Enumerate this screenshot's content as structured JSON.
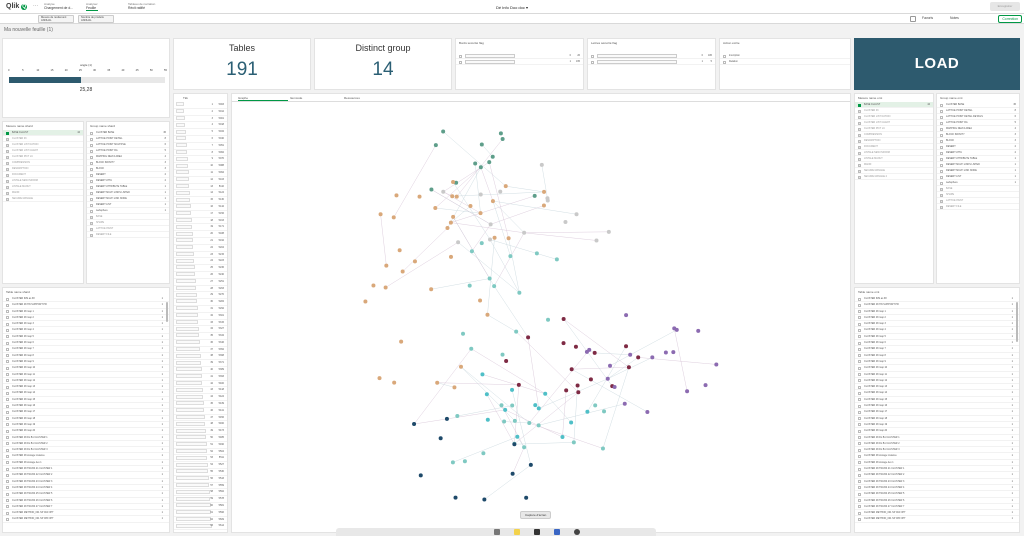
{
  "topbar": {
    "logo": "Qlik",
    "logo_mark": "Q",
    "more_glyph": "···",
    "crumbs": [
      {
        "key": "Analyse",
        "value": "Chargement de d..."
      },
      {
        "key": "Analyser",
        "value": "Feuille"
      },
      {
        "key": "Tableau de narration",
        "value": "Récit ratifié"
      }
    ],
    "app_title": "Dé Info Doo doc",
    "chevron": "▾",
    "pill1": "Modifier la feuille",
    "pill2": "Feuille",
    "edit_label": "Enregistrer"
  },
  "toolbar": {
    "selection1": "Mesure de rendement",
    "selection1b": "ANNUAL",
    "selection2": "Nombre de produits",
    "selection2b": "ANNUAL",
    "favorites": "Favoris",
    "notes": "Notes",
    "sheet_btn": "Correction"
  },
  "sheet_title": "Ma nouvelle feuille (1)",
  "slider": {
    "title": "angle (1)",
    "value": "25,28",
    "ticks": [
      "0",
      "5",
      "10",
      "15",
      "20",
      "25",
      "30",
      "35",
      "40",
      "45",
      "50",
      "55"
    ],
    "fill_fraction": 0.46
  },
  "kpi_tables": {
    "title": "Tables",
    "value": "191"
  },
  "kpi_groups": {
    "title": "Distinct group",
    "value": "14"
  },
  "filter1": {
    "title": "Bords sécurité flag",
    "rows": [
      {
        "label": "",
        "a": "0",
        "b": "26"
      },
      {
        "label": "",
        "a": "1",
        "b": "165"
      }
    ]
  },
  "filter2": {
    "title": "Lettres sécurité flag",
    "rows": [
      {
        "label": "",
        "a": "0",
        "b": "186"
      },
      {
        "label": "",
        "a": "1",
        "b": "5"
      }
    ]
  },
  "filter3": {
    "title": "Action écrite",
    "rows": [
      {
        "label": "Inscription",
        "a": "",
        "b": ""
      },
      {
        "label": "Relation",
        "a": "",
        "b": ""
      }
    ]
  },
  "load_label": "LOAD",
  "list_left1": {
    "title": "Mesure name shard",
    "items": [
      {
        "label": "BASE CLLUST",
        "n": "44",
        "state": "s"
      },
      {
        "label": "CLUSTER 03",
        "n": "",
        "state": "g"
      },
      {
        "label": "CLUSTER LIST NATION",
        "n": "",
        "state": "g"
      },
      {
        "label": "CLUSTER LIST CLIENT",
        "n": "",
        "state": "g"
      },
      {
        "label": "CLUSTER PICT LC",
        "n": "",
        "state": "g"
      },
      {
        "label": "COMPRESSION",
        "n": "",
        "state": "g"
      },
      {
        "label": "DESCRIPTION",
        "n": "",
        "state": "g"
      },
      {
        "label": "DOCUMENT",
        "n": "",
        "state": "g"
      },
      {
        "label": "LINTALE NEW INFORM",
        "n": "",
        "state": "g"
      },
      {
        "label": "LINTALE MANUT",
        "n": "",
        "state": "g"
      },
      {
        "label": "MANIF",
        "n": "",
        "state": "g"
      },
      {
        "label": "SECURE MANAGE",
        "n": "",
        "state": "g"
      }
    ]
  },
  "list_left2": {
    "title": "Group name shard",
    "items": [
      {
        "label": "CLUSTER BASE",
        "n": "36",
        "state": ""
      },
      {
        "label": "LATTICE POINT DETAIL",
        "n": "8",
        "state": ""
      },
      {
        "label": "LATTICE POINT MULTIPLE",
        "n": "6",
        "state": ""
      },
      {
        "label": "LATTICE POINT RA",
        "n": "5",
        "state": ""
      },
      {
        "label": "MAPPING DELTA AREA",
        "n": "4",
        "state": ""
      },
      {
        "label": "BLOCK INFINITY",
        "n": "3",
        "state": ""
      },
      {
        "label": "BLOCK",
        "n": "3",
        "state": ""
      },
      {
        "label": "DESERT",
        "n": "2",
        "state": ""
      },
      {
        "label": "DESERT ATTA",
        "n": "2",
        "state": ""
      },
      {
        "label": "DESERT ATTRIBUTE TABLE",
        "n": "1",
        "state": ""
      },
      {
        "label": "DESERT MULTI LINKS LISTED",
        "n": "1",
        "state": ""
      },
      {
        "label": "DESERT MULTI LINK NODE",
        "n": "1",
        "state": ""
      },
      {
        "label": "DESERT LIST",
        "n": "1",
        "state": ""
      },
      {
        "label": "websphere",
        "n": "1",
        "state": ""
      },
      {
        "label": "BASE",
        "n": "",
        "state": "g"
      },
      {
        "label": "SHAPE",
        "n": "",
        "state": "g"
      },
      {
        "label": "LATTICE PAINT",
        "n": "",
        "state": "g"
      },
      {
        "label": "DESERT FILE",
        "n": "",
        "state": "g"
      }
    ]
  },
  "list_bottom_left": {
    "title": "Table name shard",
    "items": [
      "CLUSTER IMS as 38",
      "CLUSTER 48 HN SUPPORT PR",
      "CLUSTER 48 map 1",
      "CLUSTER 48 map 2",
      "CLUSTER 48 map 3",
      "CLUSTER 48 map 4",
      "CLUSTER 48 map 5",
      "CLUSTER 48 map 6",
      "CLUSTER 48 map 7",
      "CLUSTER 48 map 8",
      "CLUSTER 48 map 9",
      "CLUSTER 48 map 10",
      "CLUSTER 48 map 11",
      "CLUSTER 48 map 12",
      "CLUSTER 48 map 13",
      "CLUSTER 48 map 14",
      "CLUSTER 48 map 15",
      "CLUSTER 48 map 16",
      "CLUSTER 48 map 17",
      "CLUSTER 48 map 18",
      "CLUSTER 48 map 19",
      "CLUSTER 48 map 20",
      "CLUSTER 48 DL B1 CLUSTER 1",
      "CLUSTER 48 DL B1 CLUSTER 2",
      "CLUSTER 48 DL B1 CLUSTER 3",
      "CLUSTER 48 storage instance",
      "CLUSTER 48 storage dev 1",
      "CLUSTER 48 TRANS 21 CLUSTER 1",
      "CLUSTER 48 TRANS 22 CLUSTER 2",
      "CLUSTER 48 TRANS 23 CLUSTER 3",
      "CLUSTER 48 TRANS 24 CLUSTER 4",
      "CLUSTER 48 TRANS 25 CLUSTER 5",
      "CLUSTER 48 TRANS 26 CLUSTER 6",
      "CLUSTER 48 TRANS 27 CLUSTER 7",
      "CLUSTER METHOD_001 SP 004 OPT",
      "CLUSTER METHOD_001 SP 005 OPT"
    ]
  },
  "numlist": {
    "title": "Tkk",
    "items": [
      [
        "1",
        "5003"
      ],
      [
        "2",
        "5012"
      ],
      [
        "3",
        "5001"
      ],
      [
        "4",
        "5018"
      ],
      [
        "5",
        "5034"
      ],
      [
        "6",
        "5040"
      ],
      [
        "7",
        "5051"
      ],
      [
        "8",
        "5062"
      ],
      [
        "9",
        "5070"
      ],
      [
        "10",
        "5088"
      ],
      [
        "11",
        "5094"
      ],
      [
        "12",
        "5103"
      ],
      [
        "13",
        "5110"
      ],
      [
        "14",
        "5124"
      ],
      [
        "15",
        "5130"
      ],
      [
        "16",
        "5142"
      ],
      [
        "17",
        "5156"
      ],
      [
        "18",
        "5163"
      ],
      [
        "19",
        "5171"
      ],
      [
        "20",
        "5188"
      ],
      [
        "21",
        "5192"
      ],
      [
        "22",
        "5204"
      ],
      [
        "23",
        "5215"
      ],
      [
        "24",
        "5223"
      ],
      [
        "25",
        "5236"
      ],
      [
        "26",
        "5240"
      ],
      [
        "27",
        "5251"
      ],
      [
        "28",
        "5263"
      ],
      [
        "29",
        "5270"
      ],
      [
        "30",
        "5284"
      ],
      [
        "31",
        "5292"
      ],
      [
        "32",
        "5301"
      ],
      [
        "33",
        "5315"
      ],
      [
        "34",
        "5327"
      ],
      [
        "35",
        "5334"
      ],
      [
        "36",
        "5346"
      ],
      [
        "37",
        "5352"
      ],
      [
        "38",
        "5368"
      ],
      [
        "39",
        "5371"
      ],
      [
        "40",
        "5389"
      ],
      [
        "41",
        "5393"
      ],
      [
        "42",
        "5400"
      ],
      [
        "43",
        "5418"
      ],
      [
        "44",
        "5424"
      ],
      [
        "45",
        "5439"
      ],
      [
        "46",
        "5441"
      ],
      [
        "47",
        "5456"
      ],
      [
        "48",
        "5460"
      ],
      [
        "49",
        "5473"
      ],
      [
        "50",
        "5485"
      ],
      [
        "51",
        "5490"
      ],
      [
        "52",
        "5504"
      ],
      [
        "53",
        "5511"
      ],
      [
        "54",
        "5527"
      ],
      [
        "55",
        "5530"
      ],
      [
        "56",
        "5543"
      ],
      [
        "57",
        "5559"
      ],
      [
        "58",
        "5562"
      ],
      [
        "59",
        "5578"
      ],
      [
        "60",
        "5581"
      ],
      [
        "61",
        "5596"
      ],
      [
        "62",
        "5609"
      ],
      [
        "63",
        "5614"
      ]
    ]
  },
  "graph_tabs": [
    "Graphe",
    "Itemcode",
    "Ressources"
  ],
  "list_right1": {
    "title": "Mesure name omt",
    "items": [
      {
        "label": "BASE CLLUST",
        "n": "44",
        "state": "s"
      },
      {
        "label": "CLUSTER 03",
        "n": "",
        "state": "g"
      },
      {
        "label": "CLUSTER LIST NATION",
        "n": "",
        "state": "g"
      },
      {
        "label": "CLUSTER LIST CLIENT",
        "n": "",
        "state": "g"
      },
      {
        "label": "CLUSTER PICT LC",
        "n": "",
        "state": "g"
      },
      {
        "label": "COMPRESSION",
        "n": "",
        "state": "g"
      },
      {
        "label": "DESCRIPTION",
        "n": "",
        "state": "g"
      },
      {
        "label": "DOCUMENT",
        "n": "",
        "state": "g"
      },
      {
        "label": "LINTALE NEW INFORM",
        "n": "",
        "state": "g"
      },
      {
        "label": "LINTALE MANUT",
        "n": "",
        "state": "g"
      },
      {
        "label": "MANIF",
        "n": "",
        "state": "g"
      },
      {
        "label": "SECURE MANAGE",
        "n": "",
        "state": "g"
      },
      {
        "label": "SECURE MANAGE 2",
        "n": "",
        "state": "g"
      }
    ]
  },
  "list_right2": {
    "title": "Group name omt",
    "items": [
      {
        "label": "CLUSTER BASE",
        "n": "36",
        "state": ""
      },
      {
        "label": "LATTICE POINT DETAIL",
        "n": "8",
        "state": ""
      },
      {
        "label": "LATTICE POINT DETAIL DETAILS",
        "n": "6",
        "state": ""
      },
      {
        "label": "LATTICE POINT RA",
        "n": "5",
        "state": ""
      },
      {
        "label": "MAPPING DELTA AREA",
        "n": "4",
        "state": ""
      },
      {
        "label": "BLOCK INFINITY",
        "n": "3",
        "state": ""
      },
      {
        "label": "BLOCK",
        "n": "3",
        "state": ""
      },
      {
        "label": "DESERT",
        "n": "2",
        "state": ""
      },
      {
        "label": "DESERT ATTA",
        "n": "2",
        "state": ""
      },
      {
        "label": "DESERT ATTRIBUTE TABLE",
        "n": "1",
        "state": ""
      },
      {
        "label": "DESERT MULTI LINKS LISTED",
        "n": "1",
        "state": ""
      },
      {
        "label": "DESERT MULTI LINK NODE",
        "n": "1",
        "state": ""
      },
      {
        "label": "DESERT LIST",
        "n": "1",
        "state": ""
      },
      {
        "label": "websphere",
        "n": "1",
        "state": ""
      },
      {
        "label": "BASE",
        "n": "",
        "state": "g"
      },
      {
        "label": "SHAPE",
        "n": "",
        "state": "g"
      },
      {
        "label": "LATTICE PAINT",
        "n": "",
        "state": "g"
      },
      {
        "label": "DESERT FILE",
        "n": "",
        "state": "g"
      }
    ]
  },
  "list_bottom_right": {
    "title": "Table name omt",
    "items": [
      "CLUSTER IMS as 38",
      "CLUSTER 48 HN SUPPORT PR",
      "CLUSTER 48 map 1",
      "CLUSTER 48 map 2",
      "CLUSTER 48 map 3",
      "CLUSTER 48 map 4",
      "CLUSTER 48 map 5",
      "CLUSTER 48 map 6",
      "CLUSTER 48 map 7",
      "CLUSTER 48 map 8",
      "CLUSTER 48 map 9",
      "CLUSTER 48 map 10",
      "CLUSTER 48 map 11",
      "CLUSTER 48 map 12",
      "CLUSTER 48 map 13",
      "CLUSTER 48 map 14",
      "CLUSTER 48 map 15",
      "CLUSTER 48 map 16",
      "CLUSTER 48 map 17",
      "CLUSTER 48 map 18",
      "CLUSTER 48 map 19",
      "CLUSTER 48 map 20",
      "CLUSTER 48 DL B1 CLUSTER 1",
      "CLUSTER 48 DL B1 CLUSTER 2",
      "CLUSTER 48 DL B1 CLUSTER 3",
      "CLUSTER 48 storage instance",
      "CLUSTER 48 storage dev 1",
      "CLUSTER 48 TRANS 21 CLUSTER 1",
      "CLUSTER 48 TRANS 22 CLUSTER 2",
      "CLUSTER 48 TRANS 23 CLUSTER 3",
      "CLUSTER 48 TRANS 24 CLUSTER 4",
      "CLUSTER 48 TRANS 25 CLUSTER 5",
      "CLUSTER 48 TRANS 26 CLUSTER 6",
      "CLUSTER 48 TRANS 27 CLUSTER 7",
      "CLUSTER METHOD_001 SP 004 OPT",
      "CLUSTER METHOD_001 SP 005 OPT"
    ]
  },
  "tooltip": "Capture d'écran",
  "colors": {
    "accent": "#009845",
    "load_bg": "#2d5a6e",
    "kpi_value": "#2b5f74",
    "node_palette": [
      "#5e9e8a",
      "#d9a87a",
      "#c9c9c9",
      "#7fc9c2",
      "#7e2a44",
      "#8c6bb1",
      "#1e4a6a",
      "#4fbfc7"
    ]
  }
}
